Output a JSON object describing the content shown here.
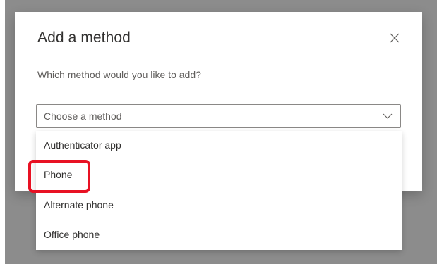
{
  "dialog": {
    "title": "Add a method",
    "question": "Which method would you like to add?",
    "close_icon": "close-icon"
  },
  "method_select": {
    "placeholder": "Choose a method",
    "chevron_icon": "chevron-down-icon",
    "options": [
      {
        "label": "Authenticator app"
      },
      {
        "label": "Phone"
      },
      {
        "label": "Alternate phone"
      },
      {
        "label": "Office phone"
      }
    ]
  },
  "annotation": {
    "highlight_color": "#e81123",
    "highlighted_option": "Phone"
  }
}
